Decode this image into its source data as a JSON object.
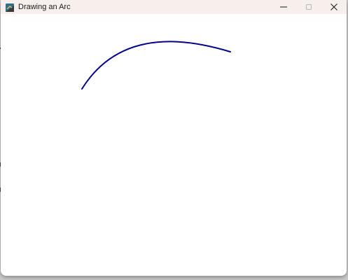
{
  "window": {
    "title": "Drawing an Arc"
  },
  "controls": {
    "minimize_icon": "minimize-icon",
    "maximize_icon": "maximize-icon",
    "close_icon": "close-icon"
  },
  "canvas": {
    "background": "#ffffff",
    "arc_color": "#00008b"
  }
}
